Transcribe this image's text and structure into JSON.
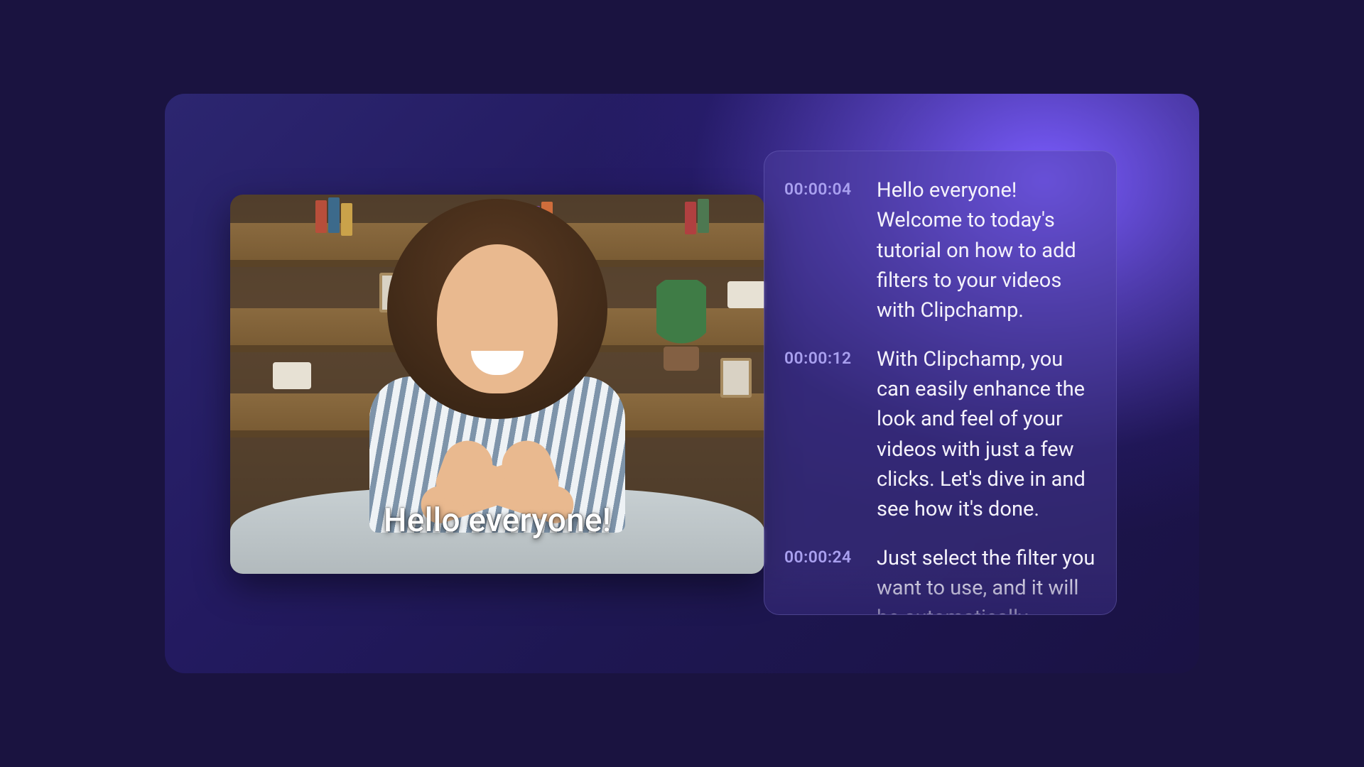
{
  "video": {
    "caption_text": "Hello everyone!"
  },
  "transcript": {
    "entries": [
      {
        "time": "00:00:04",
        "text": "Hello everyone! Welcome to today's tutorial on how to add filters to your videos with Clipchamp."
      },
      {
        "time": "00:00:12",
        "text": "With Clipchamp, you can easily enhance the look and feel of your videos with just a few clicks. Let's dive in and see how it's done."
      },
      {
        "time": "00:00:24",
        "text": "Just select the filter you want to use, and it will be automatically"
      }
    ]
  },
  "colors": {
    "timestamp": "#a9a0ef",
    "panel_bg": "rgba(78,64,160,0.42)",
    "accent_gradient_start": "#7a5cff"
  }
}
